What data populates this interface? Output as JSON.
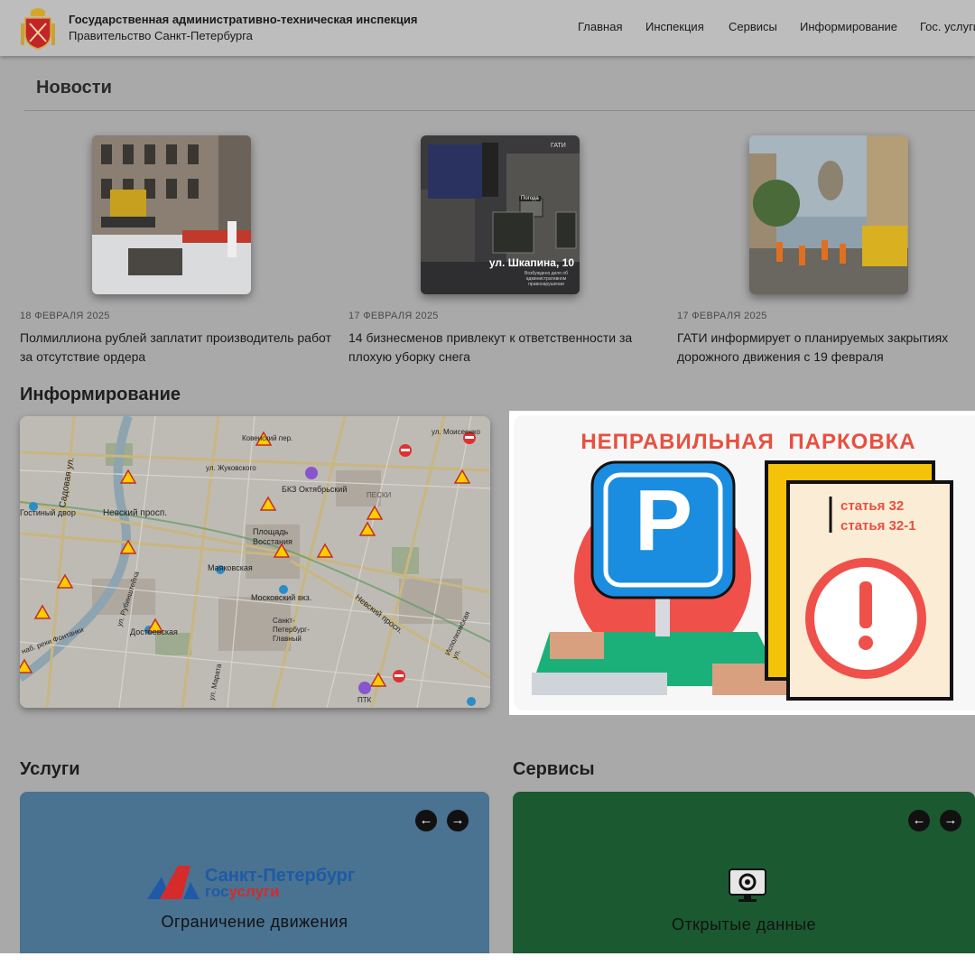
{
  "header": {
    "org_title": "Государственная административно-техническая инспекция",
    "org_subtitle": "Правительство Санкт-Петербурга",
    "nav": [
      "Главная",
      "Инспекция",
      "Сервисы",
      "Информирование",
      "Гос. услуги"
    ]
  },
  "news": {
    "heading": "Новости",
    "items": [
      {
        "date": "18 ФЕВРАЛЯ 2025",
        "title": "Полмиллиона рублей заплатит производитель работ за отсутствие ордера"
      },
      {
        "date": "17 ФЕВРАЛЯ 2025",
        "title": "14 бизнесменов привлекут к ответственности за плохую уборку снега",
        "thumb_brand": "ГАТИ",
        "thumb_sign": "Погода",
        "thumb_street": "ул. Шкапина, 10",
        "thumb_caption": "Возбуждено дело об административном правонарушении"
      },
      {
        "date": "17 ФЕВРАЛЯ 2025",
        "title": "ГАТИ информирует о планируемых закрытиях дорожного движения с 19 февраля"
      }
    ]
  },
  "informing": {
    "heading": "Информирование",
    "map_labels": {
      "kovensky": "Ковенский пер.",
      "zhukovskogo": "ул. Жуковского",
      "bkz": "БКЗ Октябрьский",
      "peski": "ПЕСКИ",
      "nevsky1": "Невский просп.",
      "ploshchad": "Площадь Восстания",
      "mayakovskaya": "Маяковская",
      "moskovsky": "Московский вкз.",
      "spb_glavny": "Санкт-Петербург-Главный",
      "dostoevskaya": "Достоевская",
      "nevsky2": "Невский просп.",
      "ptk": "ПТК",
      "sadovaya": "Садовая ул.",
      "novosty": "Гостиный двор",
      "moiseenko": "ул. Моисеенко",
      "fontanka": "наб. реки Фонтанки",
      "rubinshteina": "ул. Рубинштейна",
      "marata": "ул. Марата",
      "ispolkomskaya": "Исполкомская ул."
    },
    "parking_title": "НЕПРАВИЛЬНАЯ ПАРКОВКА",
    "parking_article_1": "статья 32",
    "parking_article_2": "статья 32-1",
    "parking_sign_letter": "P"
  },
  "services": {
    "uslugi_heading": "Услуги",
    "servisy_heading": "Сервисы",
    "uslugi_logo_city": "Санкт-Петербург",
    "uslugi_logo_gos": "гос",
    "uslugi_logo_uslugi": "услуги",
    "uslugi_caption": "Ограничение движения",
    "servisy_caption": "Открытые данные",
    "arrow_prev": "←",
    "arrow_next": "→"
  },
  "colors": {
    "overlay_gray": "#a9a9a9",
    "uslugi_card": "#4a7291",
    "servisy_card": "#1b5a31",
    "parking_red": "#e8503f",
    "parking_blue": "#1a8de0"
  }
}
